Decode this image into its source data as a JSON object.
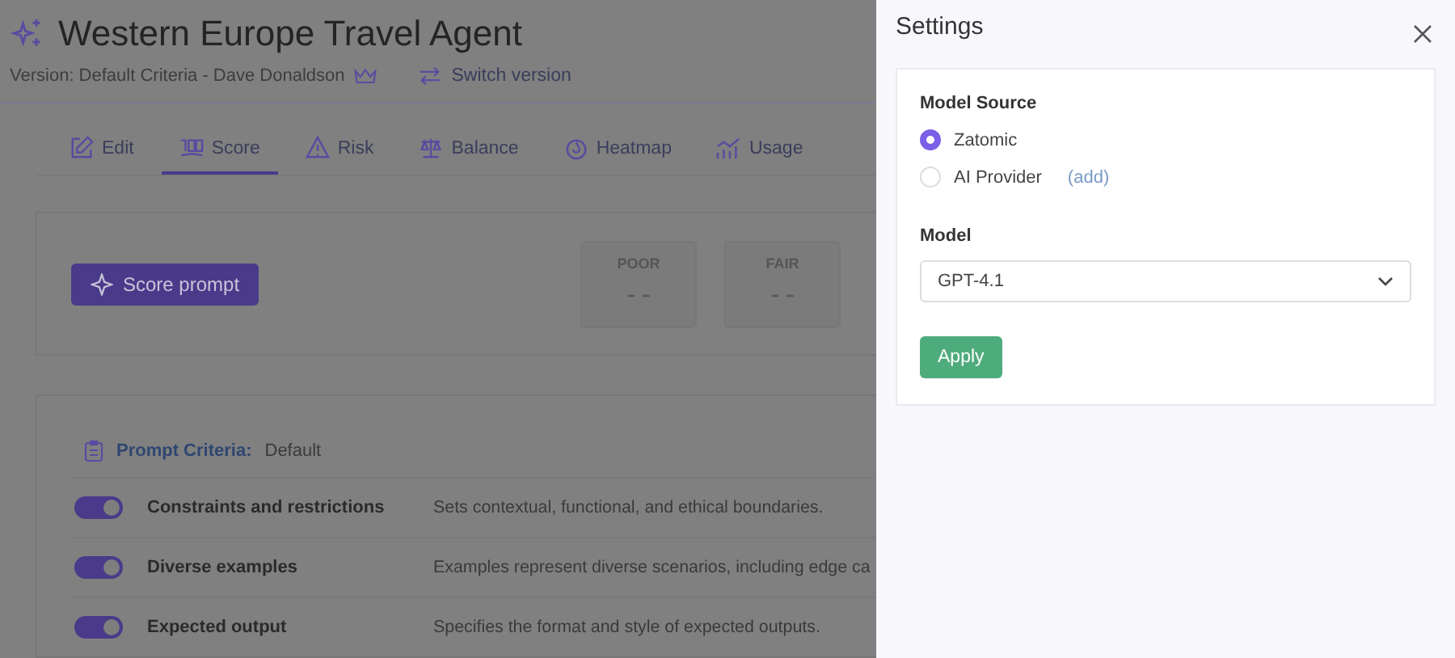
{
  "header": {
    "title": "Western Europe Travel Agent",
    "version": "Version: Default Criteria - Dave Donaldson",
    "switch_label": "Switch version"
  },
  "tabs": [
    {
      "label": "Edit",
      "selected": false
    },
    {
      "label": "Score",
      "selected": true
    },
    {
      "label": "Risk",
      "selected": false
    },
    {
      "label": "Balance",
      "selected": false
    },
    {
      "label": "Heatmap",
      "selected": false
    },
    {
      "label": "Usage",
      "selected": false
    }
  ],
  "score_panel": {
    "button": "Score prompt",
    "grades": [
      {
        "label": "POOR",
        "value": "– –"
      },
      {
        "label": "FAIR",
        "value": "– –"
      }
    ]
  },
  "criteria": {
    "label": "Prompt Criteria:",
    "value": "Default",
    "items": [
      {
        "name": "Constraints and restrictions",
        "description": "Sets contextual, functional, and ethical boundaries.",
        "on": true
      },
      {
        "name": "Diverse examples",
        "description": "Examples represent diverse scenarios, including edge ca",
        "on": true
      },
      {
        "name": "Expected output",
        "description": "Specifies the format and style of expected outputs.",
        "on": true
      }
    ]
  },
  "settings": {
    "title": "Settings",
    "source_label": "Model Source",
    "sources": [
      {
        "label": "Zatomic",
        "selected": true
      },
      {
        "label": "AI Provider",
        "selected": false,
        "link": "(add)"
      }
    ],
    "model_label": "Model",
    "model_value": "GPT-4.1",
    "apply": "Apply"
  }
}
